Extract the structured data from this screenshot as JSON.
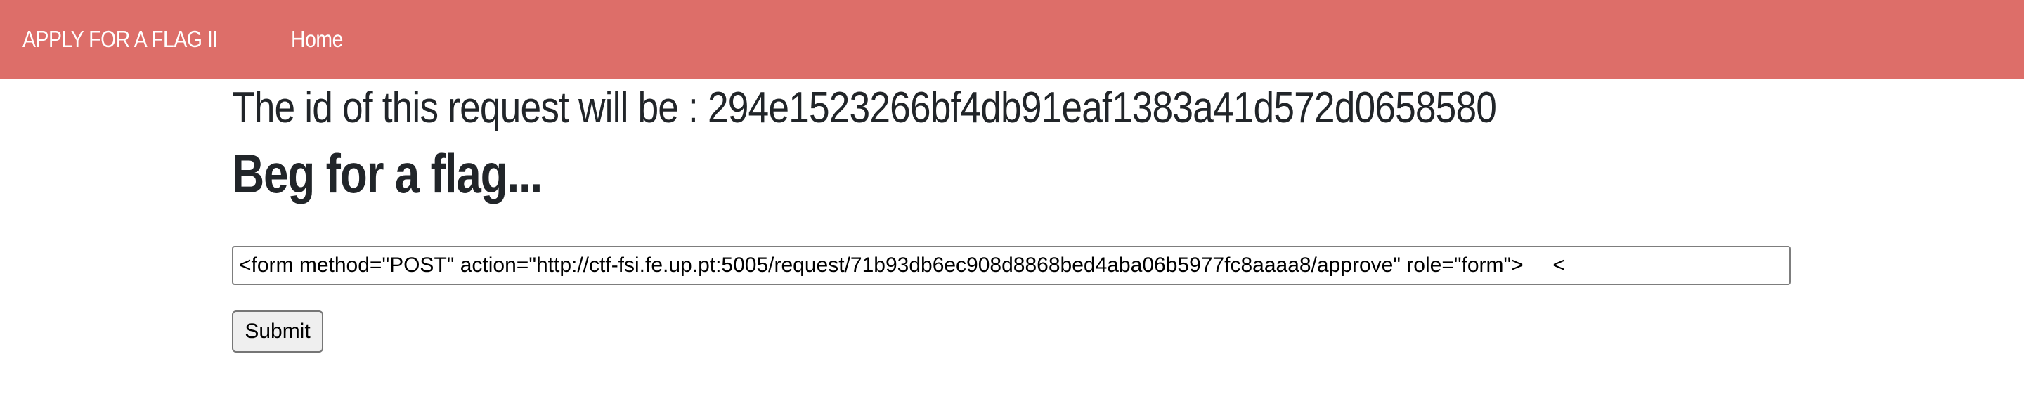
{
  "navbar": {
    "brand": "APPLY FOR A FLAG II",
    "links": [
      {
        "label": "Home"
      }
    ],
    "background_color": "#dd6e69"
  },
  "main": {
    "request_id_prefix": "The id of this request will be : ",
    "request_id_value": "294e1523266bf4db91eaf1383a41d572d0658580",
    "heading": "Beg for a flag...",
    "request_input": {
      "value": "<form method=\"POST\" action=\"http://ctf-fsi.fe.up.pt:5005/request/71b93db6ec908d8868bed4aba06b5977fc8aaaa8/approve\" role=\"form\">     <"
    },
    "submit_label": "Submit"
  }
}
